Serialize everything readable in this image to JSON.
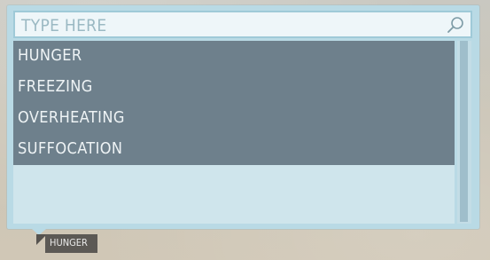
{
  "search": {
    "placeholder": "TYPE HERE",
    "icon": "search-icon"
  },
  "list": {
    "items": [
      {
        "label": "HUNGER",
        "highlighted": true
      },
      {
        "label": "FREEZING",
        "highlighted": true
      },
      {
        "label": "OVERHEATING",
        "highlighted": true
      },
      {
        "label": "SUFFOCATION",
        "highlighted": true
      }
    ]
  },
  "tooltip": {
    "label": "HUNGER"
  },
  "colors": {
    "panel": "#b9dae5",
    "item_background": "#6e808c",
    "item_text": "#eef3f5",
    "tooltip_background": "#5c5955"
  }
}
